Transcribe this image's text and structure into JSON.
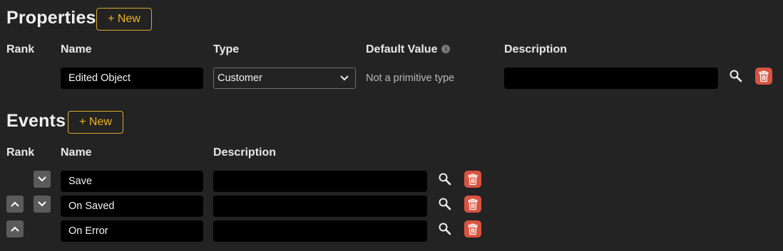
{
  "properties": {
    "title": "Properties",
    "new_label": "+ New",
    "headers": {
      "rank": "Rank",
      "name": "Name",
      "type": "Type",
      "default_value": "Default Value",
      "description": "Description"
    },
    "rows": [
      {
        "name": "Edited Object",
        "type": "Customer",
        "default_value": "Not a primitive type",
        "description": ""
      }
    ]
  },
  "events": {
    "title": "Events",
    "new_label": "+ New",
    "headers": {
      "rank": "Rank",
      "name": "Name",
      "description": "Description"
    },
    "rows": [
      {
        "name": "Save",
        "description": ""
      },
      {
        "name": "On Saved",
        "description": ""
      },
      {
        "name": "On Error",
        "description": ""
      }
    ]
  },
  "colors": {
    "accent": "#f0b323",
    "danger": "#d9533f",
    "background": "#232323"
  },
  "icons": {
    "search": "magnifier-icon",
    "delete": "trash-icon",
    "up": "chevron-up-icon",
    "down": "chevron-down-icon",
    "info": "info-icon"
  }
}
